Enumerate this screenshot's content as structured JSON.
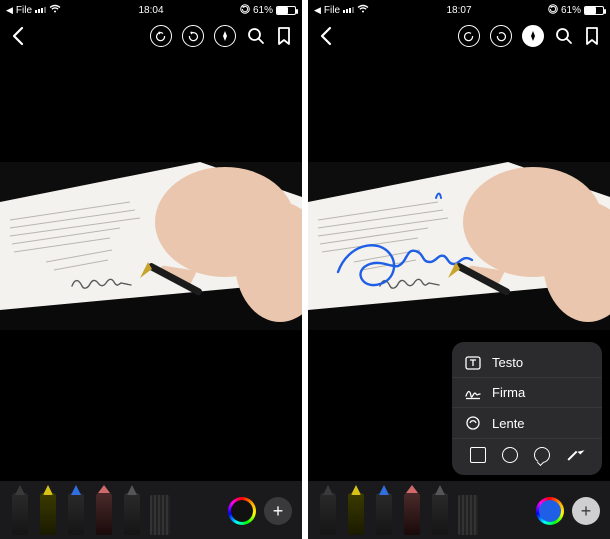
{
  "left": {
    "statusbar": {
      "back_app": "File",
      "time": "18:04",
      "battery_pct": "61%"
    },
    "toolbar": {
      "markup_selected": true
    }
  },
  "right": {
    "statusbar": {
      "back_app": "File",
      "time": "18:07",
      "battery_pct": "61%"
    },
    "toolbar": {
      "markup_selected": true
    },
    "popover": {
      "items": [
        {
          "label": "Testo"
        },
        {
          "label": "Firma"
        },
        {
          "label": "Lente"
        }
      ]
    }
  },
  "icons": {
    "back": "back-chevron-icon",
    "undo": "undo-icon",
    "redo": "redo-icon",
    "markup": "markup-pen-icon",
    "search": "search-icon",
    "bookmark": "bookmark-icon",
    "text": "text-box-icon",
    "signature": "signature-icon",
    "loupe": "loupe-icon",
    "square": "square-shape-icon",
    "circle": "circle-shape-icon",
    "speech": "speech-bubble-shape-icon",
    "arrow": "arrow-shape-icon"
  },
  "tools": [
    "pen",
    "marker",
    "pencil",
    "eraser",
    "lasso",
    "ruler"
  ]
}
